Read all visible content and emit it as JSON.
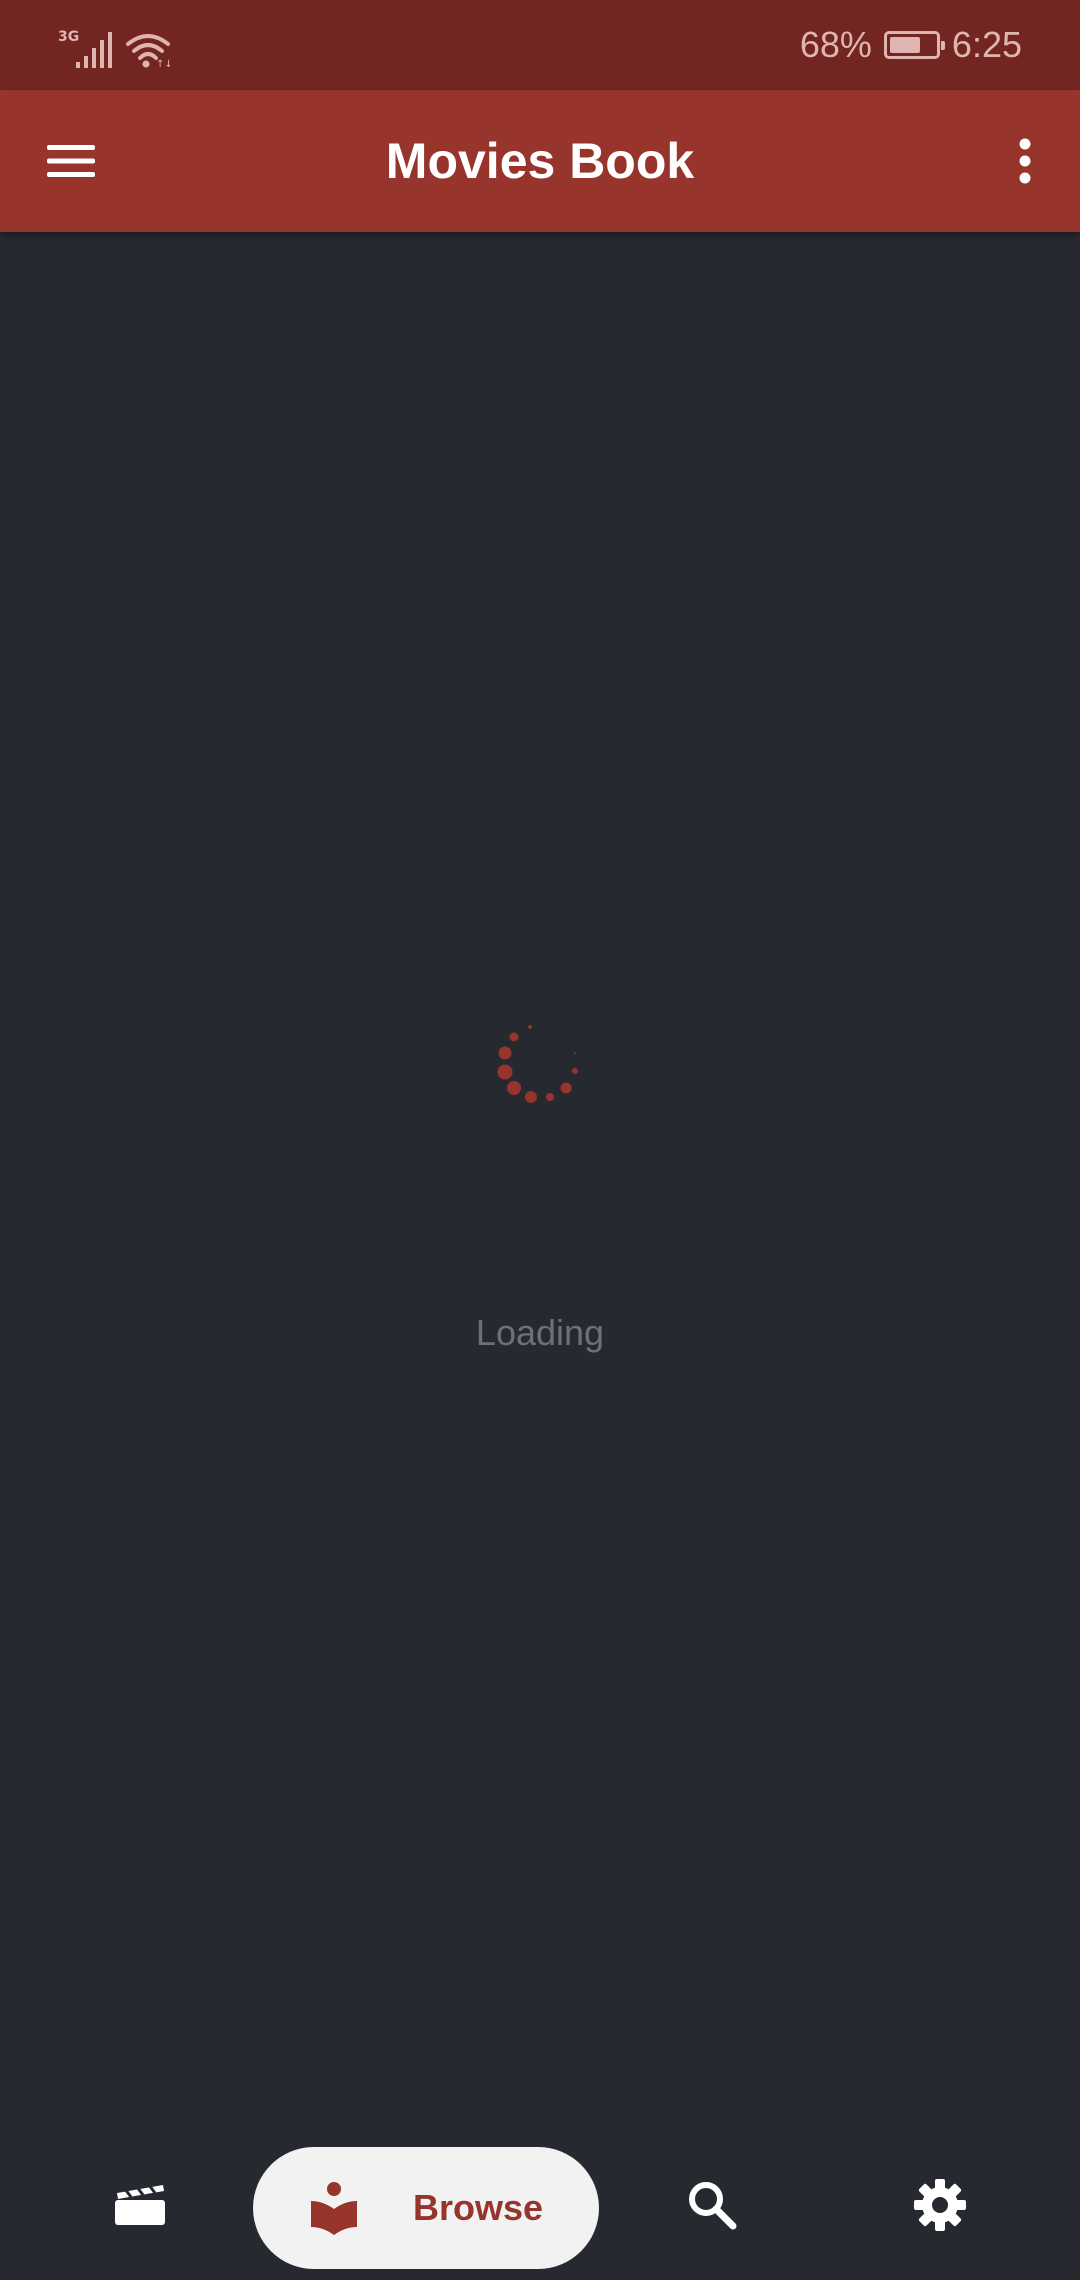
{
  "status_bar": {
    "network_label": "3G",
    "battery_text": "68%",
    "battery_level": 0.68,
    "time": "6:25"
  },
  "app_bar": {
    "title": "Movies Book"
  },
  "content": {
    "loading_text": "Loading"
  },
  "bottom_nav": {
    "items": [
      {
        "icon": "clapperboard-icon"
      },
      {
        "icon": "book-reader-icon",
        "label": "Browse",
        "selected": true
      },
      {
        "icon": "search-icon"
      },
      {
        "icon": "gear-icon"
      }
    ]
  },
  "colors": {
    "status_bar": "#722521",
    "app_bar": "#97342c",
    "background": "#262930",
    "accent": "#97342c",
    "loading_text": "#6d7078",
    "selected_pill": "#f2f2f2"
  }
}
